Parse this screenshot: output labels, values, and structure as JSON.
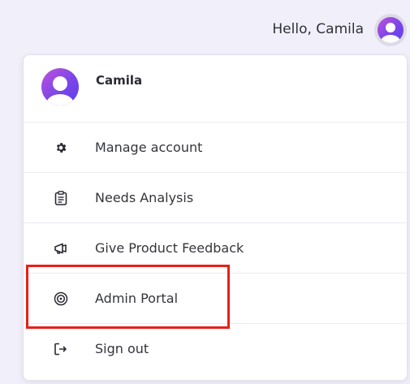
{
  "topbar": {
    "greeting": "Hello, Camila",
    "avatar_icon": "user-avatar-icon"
  },
  "menu": {
    "user_name": "Camila",
    "items": [
      {
        "label": "Manage account",
        "icon": "gear-icon"
      },
      {
        "label": "Needs Analysis",
        "icon": "clipboard-icon"
      },
      {
        "label": "Give Product Feedback",
        "icon": "megaphone-icon"
      },
      {
        "label": "Admin Portal",
        "icon": "target-icon"
      },
      {
        "label": "Sign out",
        "icon": "sign-out-icon"
      }
    ]
  },
  "annotation": {
    "highlight_color": "#e8201a",
    "highlighted_item": "Admin Portal"
  },
  "colors": {
    "background": "#f1f0fa",
    "avatar_gradient_start": "#c052dc",
    "avatar_gradient_end": "#5d3ff0"
  }
}
